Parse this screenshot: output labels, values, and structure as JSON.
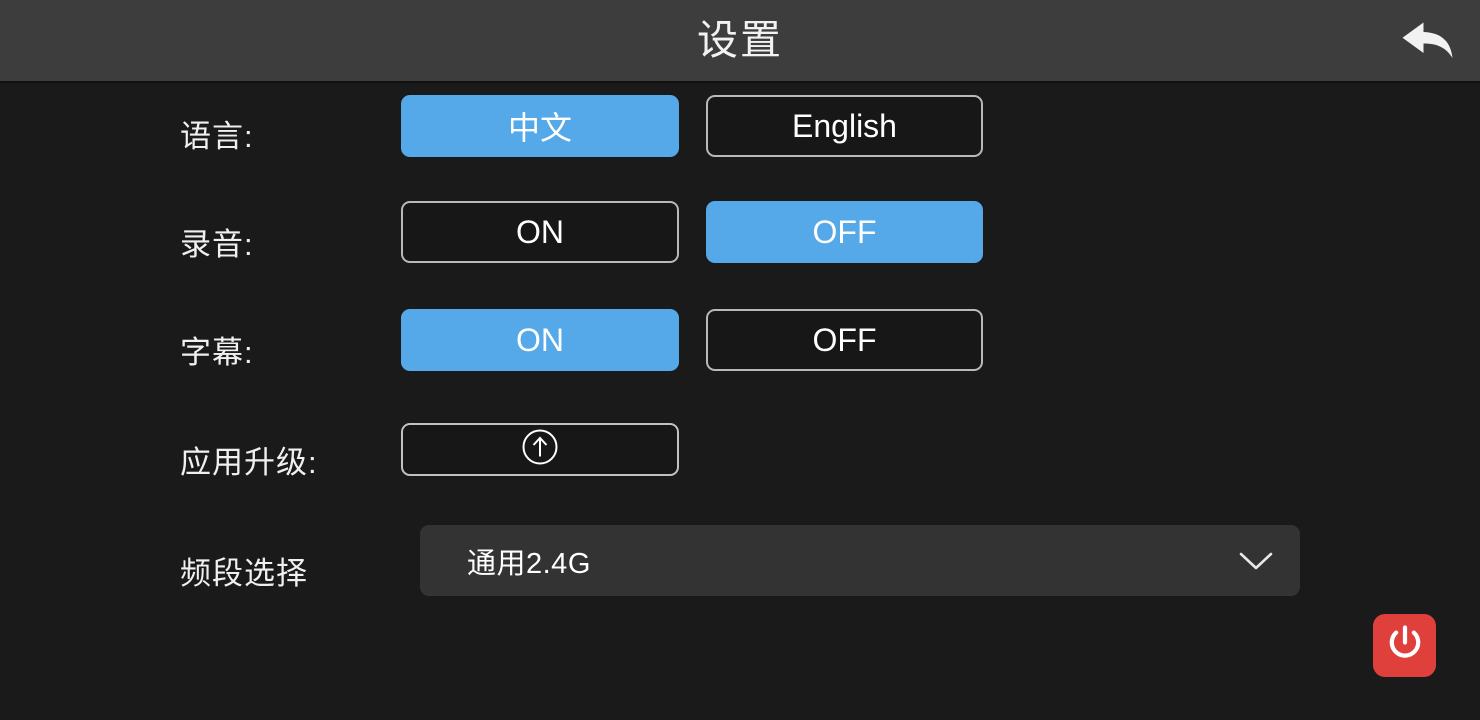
{
  "header": {
    "title": "设置",
    "back_icon": "back-arrow-icon"
  },
  "colors": {
    "accent_blue": "#55a9e8",
    "header_bg": "#3d3d3d",
    "body_bg": "#1a1a1a",
    "dropdown_bg": "#333333",
    "power_red": "#e0403c",
    "border_gray": "#b9b9b9",
    "text": "#ffffff"
  },
  "rows": [
    {
      "label": "语言:",
      "name": "language",
      "type": "toggle",
      "options": [
        {
          "label": "中文",
          "selected": true
        },
        {
          "label": "English",
          "selected": false
        }
      ]
    },
    {
      "label": "录音:",
      "name": "recording",
      "type": "toggle",
      "options": [
        {
          "label": "ON",
          "selected": false
        },
        {
          "label": "OFF",
          "selected": true
        }
      ]
    },
    {
      "label": "字幕:",
      "name": "subtitle",
      "type": "toggle",
      "options": [
        {
          "label": "ON",
          "selected": true
        },
        {
          "label": "OFF",
          "selected": false
        }
      ]
    },
    {
      "label": "应用升级:",
      "name": "app-upgrade",
      "type": "action",
      "icon": "upload-circle-icon"
    },
    {
      "label": "频段选择",
      "name": "band-select",
      "type": "dropdown",
      "value": "通用2.4G",
      "chevron_icon": "chevron-down-icon"
    }
  ],
  "power": {
    "icon": "power-icon"
  }
}
